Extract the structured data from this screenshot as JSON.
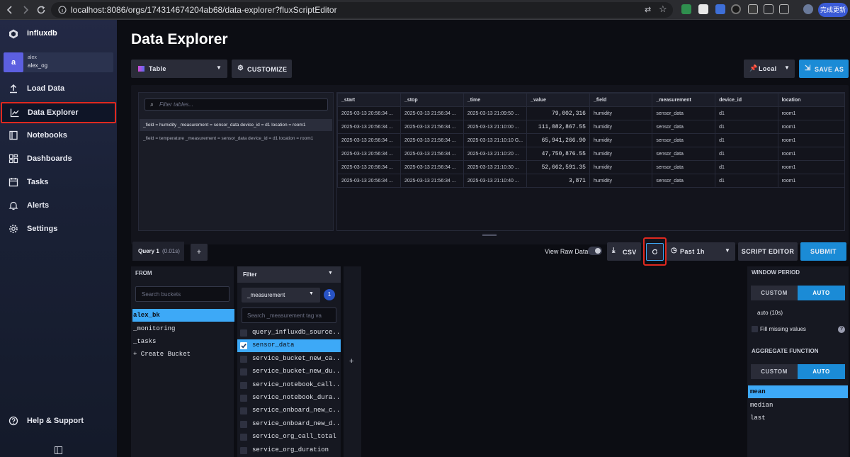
{
  "browser": {
    "url": "localhost:8086/orgs/174314674204ab68/data-explorer?fluxScriptEditor",
    "update_label": "完成更新"
  },
  "sidebar": {
    "logo_text": "influxdb",
    "user_initial": "a",
    "user_name": "alex",
    "org_name": "alex_og",
    "items": [
      {
        "label": "Load Data",
        "icon": "upload-icon"
      },
      {
        "label": "Data Explorer",
        "icon": "chart-icon"
      },
      {
        "label": "Notebooks",
        "icon": "notebook-icon"
      },
      {
        "label": "Dashboards",
        "icon": "dashboard-icon"
      },
      {
        "label": "Tasks",
        "icon": "calendar-icon"
      },
      {
        "label": "Alerts",
        "icon": "bell-icon"
      },
      {
        "label": "Settings",
        "icon": "gear-icon"
      }
    ],
    "help_label": "Help & Support"
  },
  "header": {
    "title": "Data Explorer"
  },
  "toolbar": {
    "viz_type": "Table",
    "customize_label": "CUSTOMIZE",
    "timezone": "Local",
    "save_as_label": "SAVE AS"
  },
  "tables_panel": {
    "filter_placeholder": "Filter tables...",
    "tables": [
      "_field = humidity _measurement = sensor_data device_id = d1 location = room1",
      "_field = temperature _measurement = sensor_data device_id = d1 location = room1"
    ]
  },
  "results": {
    "columns": [
      "_start",
      "_stop",
      "_time",
      "_value",
      "_field",
      "_measurement",
      "device_id",
      "location"
    ],
    "rows": [
      [
        "2025-03-13 20:56:34 ...",
        "2025-03-13 21:56:34 ...",
        "2025-03-13 21:09:50 ...",
        "79,002,316",
        "humidity",
        "sensor_data",
        "d1",
        "room1"
      ],
      [
        "2025-03-13 20:56:34 ...",
        "2025-03-13 21:56:34 ...",
        "2025-03-13 21:10:00 ...",
        "111,082,867.55",
        "humidity",
        "sensor_data",
        "d1",
        "room1"
      ],
      [
        "2025-03-13 20:56:34 ...",
        "2025-03-13 21:56:34 ...",
        "2025-03-13 21:10:10 G...",
        "65,941,266.90",
        "humidity",
        "sensor_data",
        "d1",
        "room1"
      ],
      [
        "2025-03-13 20:56:34 ...",
        "2025-03-13 21:56:34 ...",
        "2025-03-13 21:10:20 ...",
        "47,750,876.55",
        "humidity",
        "sensor_data",
        "d1",
        "room1"
      ],
      [
        "2025-03-13 20:56:34 ...",
        "2025-03-13 21:56:34 ...",
        "2025-03-13 21:10:30 ...",
        "52,662,591.35",
        "humidity",
        "sensor_data",
        "d1",
        "room1"
      ],
      [
        "2025-03-13 20:56:34 ...",
        "2025-03-13 21:56:34 ...",
        "2025-03-13 21:10:40 ...",
        "3,871",
        "humidity",
        "sensor_data",
        "d1",
        "room1"
      ]
    ]
  },
  "query_bar": {
    "query_tab": "Query 1",
    "query_time": "(0.01s)",
    "add_label": "+",
    "view_raw_label": "View Raw Data",
    "csv_label": "CSV",
    "time_range": "Past 1h",
    "script_editor_label": "SCRIPT EDITOR",
    "submit_label": "SUBMIT"
  },
  "from_panel": {
    "title": "FROM",
    "search_placeholder": "Search buckets",
    "buckets": [
      "alex_bk",
      "_monitoring",
      "_tasks",
      "+ Create Bucket"
    ],
    "selected": 0
  },
  "filter_panel": {
    "title": "Filter",
    "key": "_measurement",
    "count": "1",
    "search_placeholder": "Search _measurement tag va",
    "values": [
      {
        "label": "query_influxdb_source...",
        "checked": false
      },
      {
        "label": "sensor_data",
        "checked": true
      },
      {
        "label": "service_bucket_new_ca...",
        "checked": false
      },
      {
        "label": "service_bucket_new_du...",
        "checked": false
      },
      {
        "label": "service_notebook_call...",
        "checked": false
      },
      {
        "label": "service_notebook_dura...",
        "checked": false
      },
      {
        "label": "service_onboard_new_c...",
        "checked": false
      },
      {
        "label": "service_onboard_new_d...",
        "checked": false
      },
      {
        "label": "service_org_call_total",
        "checked": false
      },
      {
        "label": "service_org_duration",
        "checked": false
      }
    ],
    "add_filter_label": "+"
  },
  "aggregate_panel": {
    "window_period_title": "WINDOW PERIOD",
    "custom_label": "CUSTOM",
    "auto_label": "AUTO",
    "window_value": "auto (10s)",
    "fill_missing_label": "Fill missing values",
    "aggregate_title": "AGGREGATE FUNCTION",
    "functions": [
      "mean",
      "median",
      "last"
    ],
    "selected_function": 0
  },
  "colors": {
    "accent": "#1b8bd6",
    "highlight": "#3da9f7",
    "annotation_red": "#e0291f"
  }
}
